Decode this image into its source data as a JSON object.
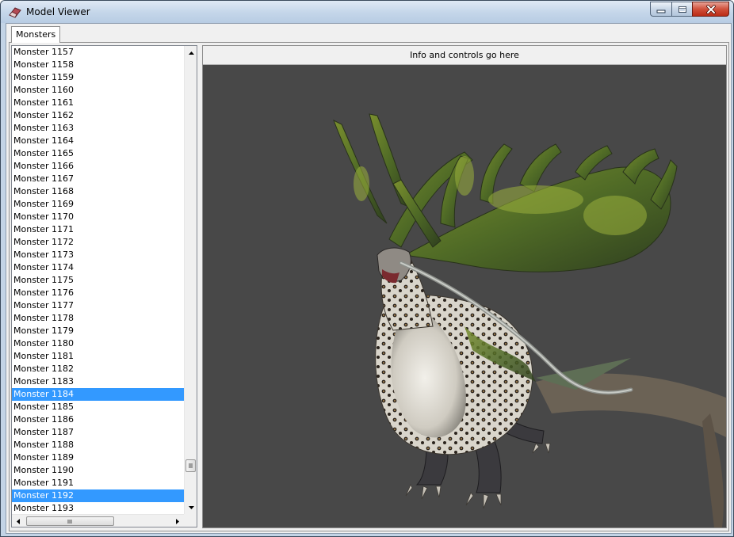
{
  "window": {
    "title": "Model Viewer"
  },
  "tabs": [
    {
      "label": "Monsters"
    }
  ],
  "list": {
    "items": [
      "Monster 1157",
      "Monster 1158",
      "Monster 1159",
      "Monster 1160",
      "Monster 1161",
      "Monster 1162",
      "Monster 1163",
      "Monster 1164",
      "Monster 1165",
      "Monster 1166",
      "Monster 1167",
      "Monster 1168",
      "Monster 1169",
      "Monster 1170",
      "Monster 1171",
      "Monster 1172",
      "Monster 1173",
      "Monster 1174",
      "Monster 1175",
      "Monster 1176",
      "Monster 1177",
      "Monster 1178",
      "Monster 1179",
      "Monster 1180",
      "Monster 1181",
      "Monster 1182",
      "Monster 1183",
      "Monster 1184",
      "Monster 1185",
      "Monster 1186",
      "Monster 1187",
      "Monster 1188",
      "Monster 1189",
      "Monster 1190",
      "Monster 1191",
      "Monster 1192",
      "Monster 1193"
    ],
    "selected": [
      "Monster 1184",
      "Monster 1192"
    ],
    "selection_color": "#3399ff"
  },
  "viewer": {
    "info_text": "Info and controls go here",
    "background_color": "#484848"
  },
  "icons": {
    "app": "eraser-icon",
    "minimize": "minimize-icon",
    "maximize": "maximize-icon",
    "close": "close-icon"
  }
}
